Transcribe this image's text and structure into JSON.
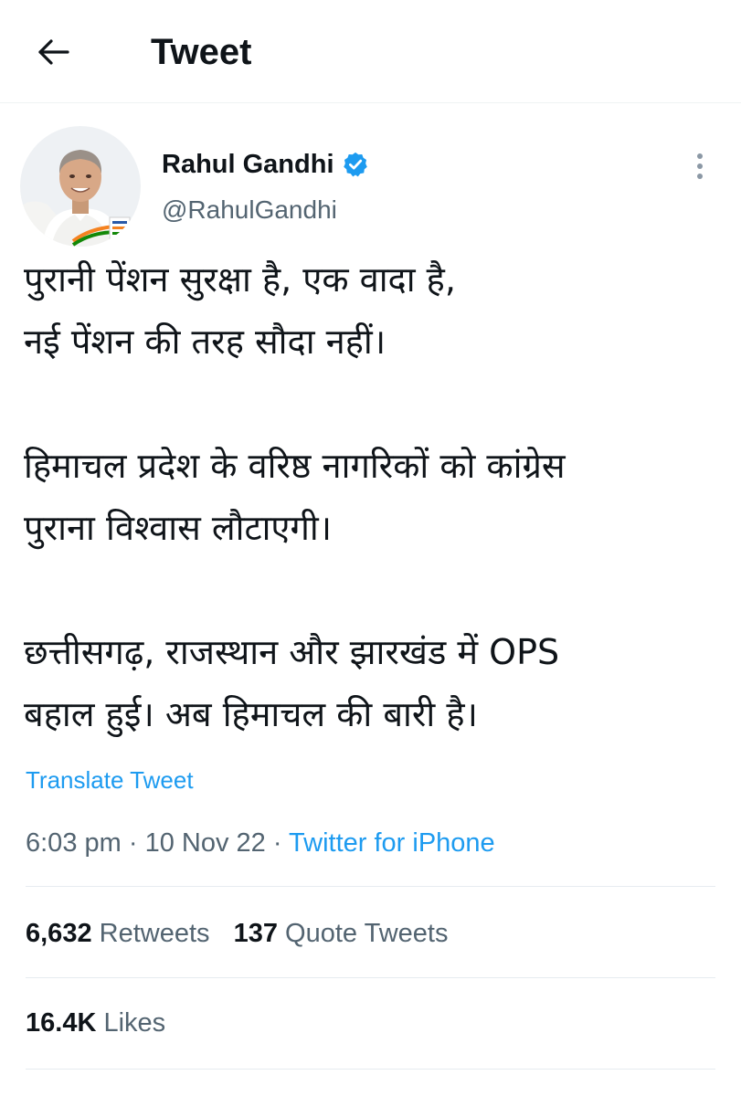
{
  "header": {
    "title": "Tweet",
    "back_icon": "arrow-left-icon"
  },
  "author": {
    "name": "Rahul Gandhi",
    "handle": "@RahulGandhi",
    "verified_icon": "verified-badge-icon",
    "verified_color": "#1d9bf0"
  },
  "tweet": {
    "paragraphs": [
      {
        "line1": "पुरानी पेंशन सुरक्षा है, एक वादा है,",
        "line2": "नई पेंशन की तरह सौदा नहीं।"
      },
      {
        "line1": "हिमाचल प्रदेश के वरिष्ठ नागरिकों को कांग्रेस",
        "line2": "पुराना विश्वास लौटाएगी।"
      },
      {
        "line1": "छत्तीसगढ़, राजस्थान और झारखंड में OPS",
        "line2": "बहाल हुई। अब हिमाचल की बारी है।"
      }
    ],
    "translate_label": "Translate Tweet",
    "time": "6:03 pm",
    "separator": " · ",
    "date": "10 Nov 22",
    "source": "Twitter for iPhone"
  },
  "stats": {
    "retweets_count": "6,632",
    "retweets_label": "Retweets",
    "quotes_count": "137",
    "quotes_label": "Quote Tweets",
    "likes_count": "16.4K",
    "likes_label": "Likes"
  },
  "colors": {
    "accent": "#1d9bf0",
    "text": "#0f1419",
    "secondary": "#536471"
  }
}
